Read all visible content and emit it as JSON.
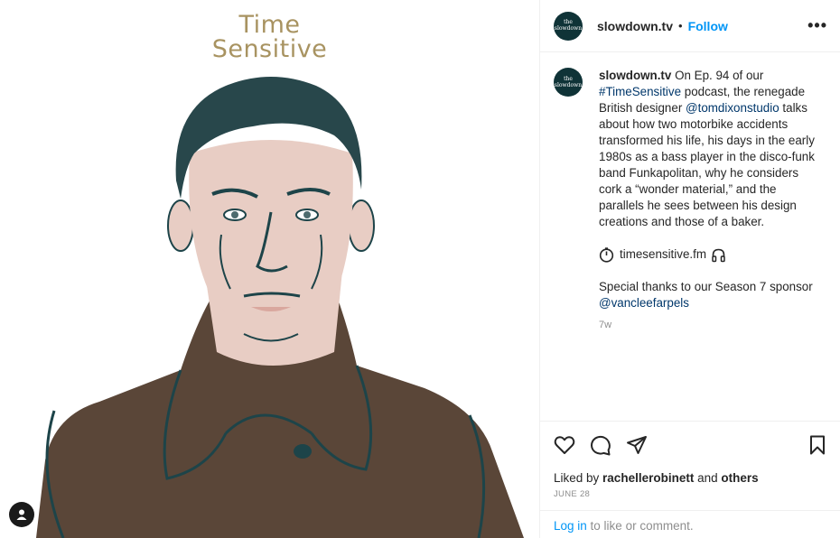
{
  "post": {
    "image_title_line1": "Time",
    "image_title_line2": "Sensitive"
  },
  "account": {
    "avatar_line1": "the",
    "avatar_line2": "slowdown",
    "username": "slowdown.tv",
    "separator": "•",
    "follow_label": "Follow",
    "more_label": "•••"
  },
  "caption": {
    "username": "slowdown.tv",
    "text_1": " On Ep. 94 of our ",
    "hashtag": "#TimeSensitive",
    "text_2": " podcast, the renegade British designer ",
    "mention_1": "@tomdixonstudio",
    "text_3": " talks about how two motorbike accidents transformed his life, his days in the early 1980s as a bass player in the disco-funk band Funkapolitan, why he considers cork a “wonder material,” and the parallels he sees between his design creations and those of a baker.",
    "link_text": "timesensitive.fm",
    "thanks_text": "Special thanks to our Season 7 sponsor ",
    "mention_2": "@vancleefarpels",
    "time_ago": "7w"
  },
  "actions": {
    "like_icon": "heart-icon",
    "comment_icon": "comment-icon",
    "share_icon": "paper-plane-icon",
    "save_icon": "bookmark-icon"
  },
  "likes": {
    "prefix": "Liked by ",
    "user": "rachellerobinett",
    "middle": " and ",
    "others": "others"
  },
  "date": "JUNE 28",
  "login": {
    "link": "Log in",
    "rest": " to like or comment."
  },
  "colors": {
    "accent": "#0095f6",
    "link": "#00376b",
    "avatar_bg": "#0f3337",
    "title_gold": "#a89361",
    "coat": "#5a4638",
    "skin": "#e8cdc4",
    "hair": "#28474b"
  }
}
